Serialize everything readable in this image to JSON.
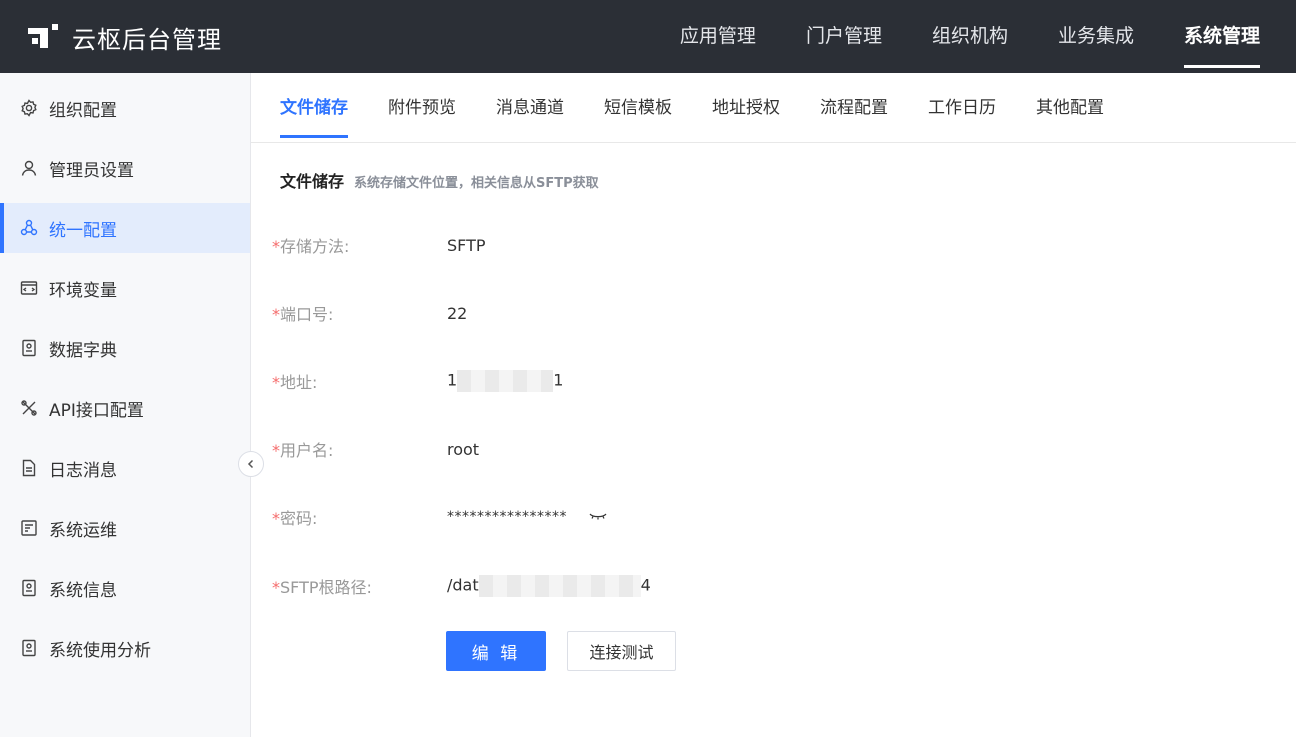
{
  "header": {
    "app_title": "云枢后台管理",
    "nav": [
      {
        "label": "应用管理"
      },
      {
        "label": "门户管理"
      },
      {
        "label": "组织机构"
      },
      {
        "label": "业务集成"
      },
      {
        "label": "系统管理",
        "active": true
      }
    ]
  },
  "sidebar": {
    "items": [
      {
        "label": "组织配置",
        "icon": "gear-icon"
      },
      {
        "label": "管理员设置",
        "icon": "user-icon"
      },
      {
        "label": "统一配置",
        "icon": "cluster-icon",
        "active": true
      },
      {
        "label": "环境变量",
        "icon": "code-window-icon"
      },
      {
        "label": "数据字典",
        "icon": "book-icon"
      },
      {
        "label": "API接口配置",
        "icon": "tools-icon"
      },
      {
        "label": "日志消息",
        "icon": "document-icon"
      },
      {
        "label": "系统运维",
        "icon": "maintenance-icon"
      },
      {
        "label": "系统信息",
        "icon": "info-file-icon"
      },
      {
        "label": "系统使用分析",
        "icon": "analysis-icon"
      }
    ]
  },
  "tabs": [
    {
      "label": "文件储存",
      "active": true
    },
    {
      "label": "附件预览"
    },
    {
      "label": "消息通道"
    },
    {
      "label": "短信模板"
    },
    {
      "label": "地址授权"
    },
    {
      "label": "流程配置"
    },
    {
      "label": "工作日历"
    },
    {
      "label": "其他配置"
    }
  ],
  "section": {
    "title": "文件储存",
    "description": "系统存储文件位置，相关信息从SFTP获取"
  },
  "form": {
    "required_mark": "*",
    "fields": [
      {
        "label": "存储方法:",
        "value": "SFTP"
      },
      {
        "label": "端口号:",
        "value": "22"
      },
      {
        "label": "地址:",
        "value_prefix": "1",
        "value_suffix": "1"
      },
      {
        "label": "用户名:",
        "value": "root"
      },
      {
        "label": "密码:",
        "value": "****************"
      },
      {
        "label": "SFTP根路径:",
        "value_prefix": "/dat",
        "value_suffix": "4"
      }
    ]
  },
  "buttons": {
    "edit": "编 辑",
    "test_connection": "连接测试"
  },
  "colors": {
    "topbar_bg": "#2b2f36",
    "accent": "#2f74ff",
    "required": "#f56c6c",
    "sidebar_bg": "#f7f8fa",
    "sidebar_active_bg": "#e3ecfc"
  }
}
